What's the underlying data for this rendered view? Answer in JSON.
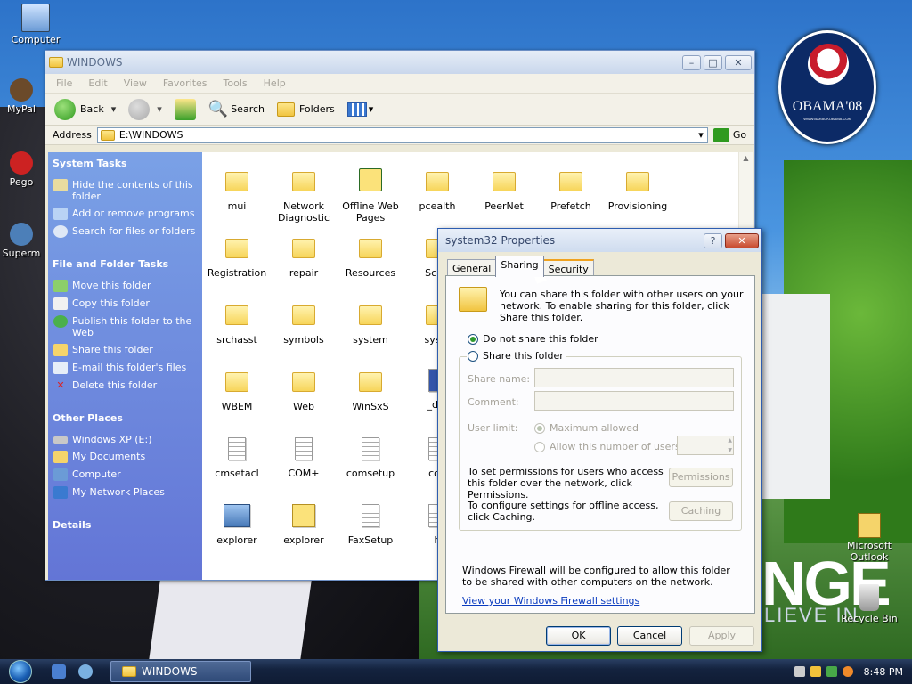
{
  "desktop": {
    "icons": [
      {
        "label": "Computer",
        "icon": "computer-icon"
      },
      {
        "label": "MyPal",
        "icon": "browser-icon"
      },
      {
        "label": "Pego",
        "icon": "app-icon"
      },
      {
        "label": "Superm",
        "icon": "app-icon"
      },
      {
        "label": "Microsoft Outlook",
        "icon": "outlook-icon"
      },
      {
        "label": "Recycle Bin",
        "icon": "recycle-bin-icon"
      }
    ],
    "wallpaper": {
      "badge_text": "OBAMA'08",
      "badge_url": "WWW.BARACKOBAMA.COM",
      "big_text": "NGE",
      "small_text": "LIEVE IN"
    }
  },
  "explorer": {
    "title": "WINDOWS",
    "menu": [
      "File",
      "Edit",
      "View",
      "Favorites",
      "Tools",
      "Help"
    ],
    "toolbar": {
      "back": "Back",
      "search": "Search",
      "folders": "Folders"
    },
    "address": {
      "label": "Address",
      "value": "E:\\WINDOWS",
      "go": "Go"
    },
    "sidebar": {
      "system_tasks": {
        "title": "System Tasks",
        "items": [
          "Hide the contents of this folder",
          "Add or remove programs",
          "Search for files or folders"
        ]
      },
      "folder_tasks": {
        "title": "File and Folder Tasks",
        "items": [
          "Move this folder",
          "Copy this folder",
          "Publish this folder to the Web",
          "Share this folder",
          "E-mail this folder's files",
          "Delete this folder"
        ]
      },
      "other_places": {
        "title": "Other Places",
        "items": [
          "Windows XP (E:)",
          "My Documents",
          "Computer",
          "My Network Places"
        ]
      },
      "details": {
        "title": "Details"
      }
    },
    "files": [
      [
        "mui",
        "Network Diagnostic",
        "Offline Web Pages",
        "pcealth",
        "PeerNet",
        "Prefetch",
        "Provisioning"
      ],
      [
        "Registration",
        "repair",
        "Resources",
        "SchC"
      ],
      [
        "srchasst",
        "symbols",
        "system",
        "syste"
      ],
      [
        "WBEM",
        "Web",
        "WinSxS",
        "_def"
      ],
      [
        "cmsetacl",
        "COM+",
        "comsetup",
        "con"
      ],
      [
        "explorer",
        "explorer",
        "FaxSetup",
        "h"
      ]
    ]
  },
  "dialog": {
    "title": "system32 Properties",
    "tabs": [
      "General",
      "Sharing",
      "Security"
    ],
    "active_tab": "Sharing",
    "description": "You can share this folder with other users on your network.  To enable sharing for this folder, click Share this folder.",
    "do_not_share": "Do not share this folder",
    "share": "Share this folder",
    "share_name_label": "Share name:",
    "comment_label": "Comment:",
    "user_limit_label": "User limit:",
    "max_allowed": "Maximum allowed",
    "allow_number": "Allow this number of users:",
    "permissions_text": "To set permissions for users who access this folder over the network, click Permissions.",
    "permissions_button": "Permissions",
    "caching_text": "To configure settings for offline access, click Caching.",
    "caching_button": "Caching",
    "firewall_text": "Windows Firewall will be configured to allow this folder to be shared with other computers on the network.",
    "firewall_link": "View your Windows Firewall settings",
    "ok": "OK",
    "cancel": "Cancel",
    "apply": "Apply"
  },
  "taskbar": {
    "task_label": "WINDOWS",
    "clock": "8:48 PM"
  }
}
